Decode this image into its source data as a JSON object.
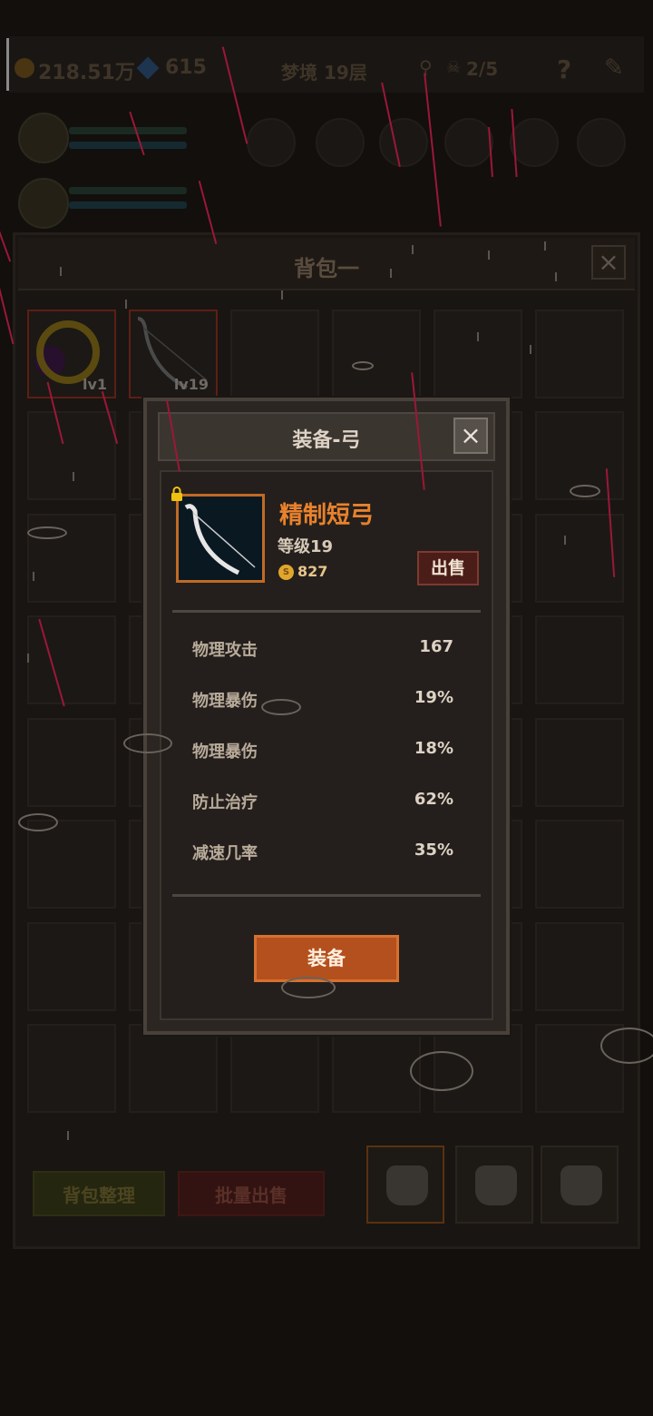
{
  "hud": {
    "gold": "218.51万",
    "gems": "615",
    "dungeon": "梦境 19层",
    "skull_count": "2/5",
    "help": "?"
  },
  "bag": {
    "title": "背包一",
    "close": "×",
    "items": [
      {
        "level": "lv1",
        "kind": "ring"
      },
      {
        "level": "lv19",
        "kind": "bow"
      }
    ],
    "sort_label": "背包整理",
    "bulk_sell_label": "批量出售"
  },
  "dialog": {
    "title": "装备-弓",
    "close": "×",
    "item_name": "精制短弓",
    "item_level": "等级19",
    "price": "827",
    "coin_symbol": "S",
    "sell_label": "出售",
    "stats": [
      {
        "name": "物理攻击",
        "value": "167"
      },
      {
        "name": "物理暴伤",
        "value": "19%"
      },
      {
        "name": "物理暴伤",
        "value": "18%"
      },
      {
        "name": "防止治疗",
        "value": "62%"
      },
      {
        "name": "减速几率",
        "value": "35%"
      }
    ],
    "equip_label": "装备"
  },
  "colors": {
    "accent_orange": "#e8822d",
    "equip_button": "#b4501e",
    "sell_button": "#4a1d18",
    "rain": "#9a1836"
  }
}
